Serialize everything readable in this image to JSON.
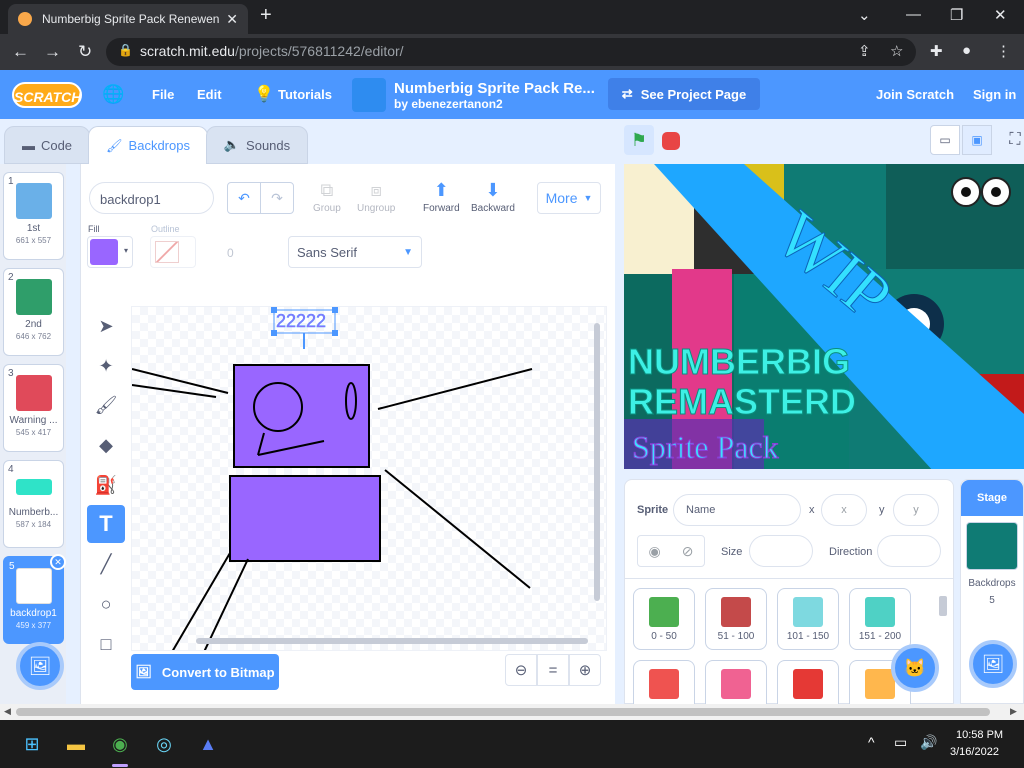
{
  "browser": {
    "tab_title": "Numberbig Sprite Pack Renewen",
    "url_host": "scratch.mit.edu",
    "url_path": "/projects/576811242/editor/"
  },
  "menubar": {
    "logo": "SCRATCH",
    "file": "File",
    "edit": "Edit",
    "tutorials": "Tutorials",
    "project_title": "Numberbig Sprite Pack Re...",
    "author": "by ebenezertanon2",
    "see_project": "See Project Page",
    "join": "Join Scratch",
    "signin": "Sign in"
  },
  "tabs": {
    "code": "Code",
    "backdrops": "Backdrops",
    "sounds": "Sounds"
  },
  "backdrops": [
    {
      "num": "1",
      "name": "1st",
      "size": "661 x 557",
      "color": "#6ab0e8"
    },
    {
      "num": "2",
      "name": "2nd",
      "size": "646 x 762",
      "color": "#2f9e6a"
    },
    {
      "num": "3",
      "name": "Warning ...",
      "size": "545 x 417",
      "color": "#e04a5a"
    },
    {
      "num": "4",
      "name": "Numberb...",
      "size": "587 x 184",
      "color": "#2fe3c8"
    },
    {
      "num": "5",
      "name": "backdrop1",
      "size": "459 x 377",
      "color": "#9966ff"
    }
  ],
  "paint": {
    "costume_name": "backdrop1",
    "group": "Group",
    "ungroup": "Ungroup",
    "forward": "Forward",
    "backward": "Backward",
    "more": "More",
    "fill_label": "Fill",
    "outline_label": "Outline",
    "outline_width": "0",
    "font": "Sans Serif",
    "text_content": "22222",
    "convert": "Convert to Bitmap",
    "fill_color": "#9966ff"
  },
  "stage": {
    "wip": "WIP",
    "title1": "NUMBERBIG",
    "title2": "REMASTERD",
    "title3": "Sprite Pack"
  },
  "sprite_info": {
    "sprite_label": "Sprite",
    "name_placeholder": "Name",
    "x_label": "x",
    "x_placeholder": "x",
    "y_label": "y",
    "y_placeholder": "y",
    "size_label": "Size",
    "direction_label": "Direction"
  },
  "sprites": [
    {
      "name": "0 - 50",
      "color": "#4caf50"
    },
    {
      "name": "51 - 100",
      "color": "#c44a4a"
    },
    {
      "name": "101 - 150",
      "color": "#7ed9e0"
    },
    {
      "name": "151 - 200",
      "color": "#4fd1c5"
    },
    {
      "name": "",
      "color": "#ef5350"
    },
    {
      "name": "",
      "color": "#f06292"
    },
    {
      "name": "",
      "color": "#e53935"
    },
    {
      "name": "",
      "color": "#ffb74d"
    }
  ],
  "stage_pane": {
    "header": "Stage",
    "backdrops_label": "Backdrops",
    "backdrops_count": "5"
  },
  "taskbar": {
    "time": "10:58 PM",
    "date": "3/16/2022"
  }
}
